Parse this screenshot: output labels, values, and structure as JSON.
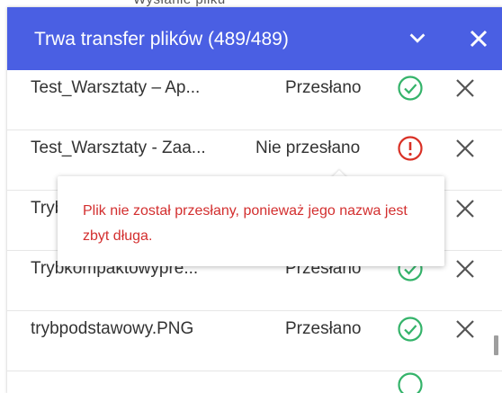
{
  "background_peek_text": "Wysłanie pliku",
  "header": {
    "title": "Trwa transfer plików (489/489)",
    "collapse_icon": "chevron-down-icon",
    "close_icon": "close-icon",
    "color": "#4a5fe3"
  },
  "files": [
    {
      "name": "Test_Warsztaty – Ap...",
      "status": "Przesłano",
      "state": "success",
      "status_icon": "check-circle-icon",
      "remove_icon": "close-icon"
    },
    {
      "name": "Test_Warsztaty - Zaa...",
      "status": "Nie przesłano",
      "state": "error",
      "status_icon": "alert-circle-icon",
      "remove_icon": "close-icon"
    },
    {
      "name": "Tryb",
      "status": "",
      "state": "success",
      "status_icon": "check-circle-icon",
      "remove_icon": "close-icon"
    },
    {
      "name": "Trybkompaktowypre...",
      "status": "Przesłano",
      "state": "success",
      "status_icon": "check-circle-icon",
      "remove_icon": "close-icon"
    },
    {
      "name": "trybpodstawowy.PNG",
      "status": "Przesłano",
      "state": "success",
      "status_icon": "check-circle-icon",
      "remove_icon": "close-icon"
    }
  ],
  "tooltip": {
    "message": "Plik nie został przesłany, ponieważ jego nazwa jest zbyt długa."
  },
  "colors": {
    "success": "#34b36a",
    "error": "#d93025",
    "tooltip_text": "#d32f2f"
  }
}
